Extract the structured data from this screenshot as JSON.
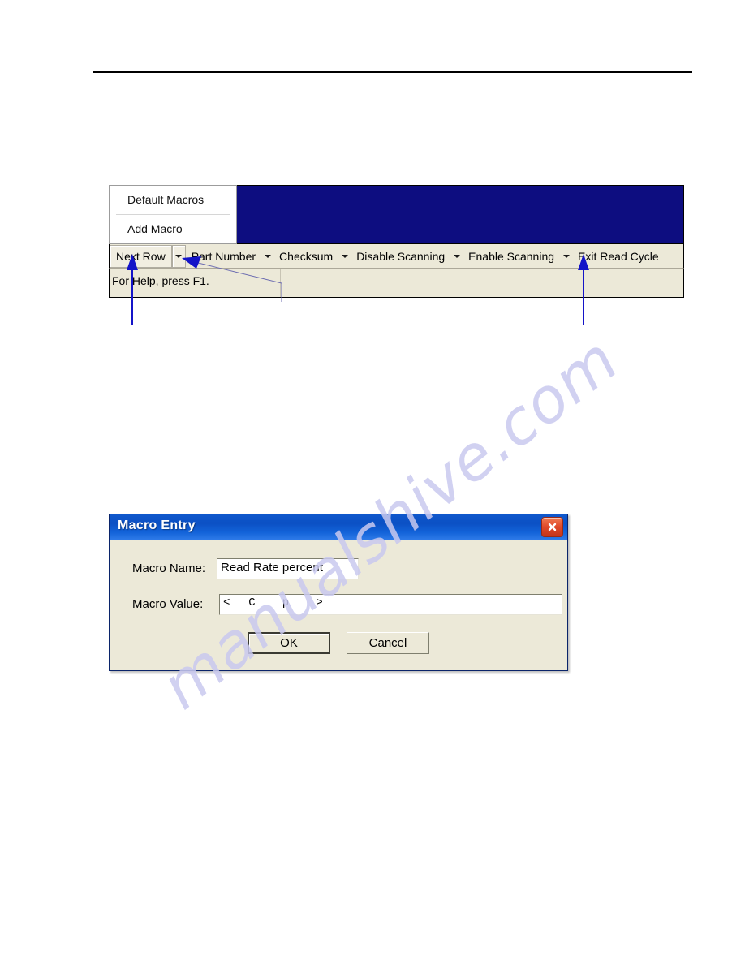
{
  "page": {
    "rule": "horizontal-rule",
    "watermark": "manualshive.com"
  },
  "toolbar_screenshot": {
    "menu": {
      "items": [
        {
          "label": "Default Macros"
        },
        {
          "label": "Add Macro"
        }
      ]
    },
    "macro_buttons": [
      {
        "label": "Next Row",
        "has_caret": true,
        "raised": true
      },
      {
        "label": "Part Number",
        "has_caret": true,
        "raised": false
      },
      {
        "label": "Checksum",
        "has_caret": true,
        "raised": false
      },
      {
        "label": "Disable Scanning",
        "has_caret": true,
        "raised": false
      },
      {
        "label": "Enable Scanning",
        "has_caret": true,
        "raised": false
      },
      {
        "label": "Exit Read Cycle",
        "has_caret": false,
        "raised": false
      }
    ],
    "status_bar": {
      "text": "For Help, press F1."
    },
    "client_area_color": "#0d0d80",
    "toolbar_color": "#ece9d8"
  },
  "annotations": {
    "accent_color": "#1414c8",
    "arrows": [
      {
        "name": "arrow-next-row",
        "points_to": "Next Row"
      },
      {
        "name": "arrow-part-number-caret",
        "points_to": "Part Number dropdown caret"
      },
      {
        "name": "arrow-exit-read-cycle-caret",
        "points_to": "Exit Read Cycle dropdown caret"
      }
    ]
  },
  "dialog": {
    "title": "Macro Entry",
    "close_label": "close-icon",
    "fields": [
      {
        "label": "Macro Name:",
        "value": "Read Rate percent"
      },
      {
        "label": "Macro Value:",
        "value": "<  C   p   >"
      }
    ],
    "buttons": [
      {
        "label": "OK",
        "default": true
      },
      {
        "label": "Cancel",
        "default": false
      }
    ],
    "titlebar_color": "#0b50c4",
    "face_color": "#ece9d8"
  }
}
